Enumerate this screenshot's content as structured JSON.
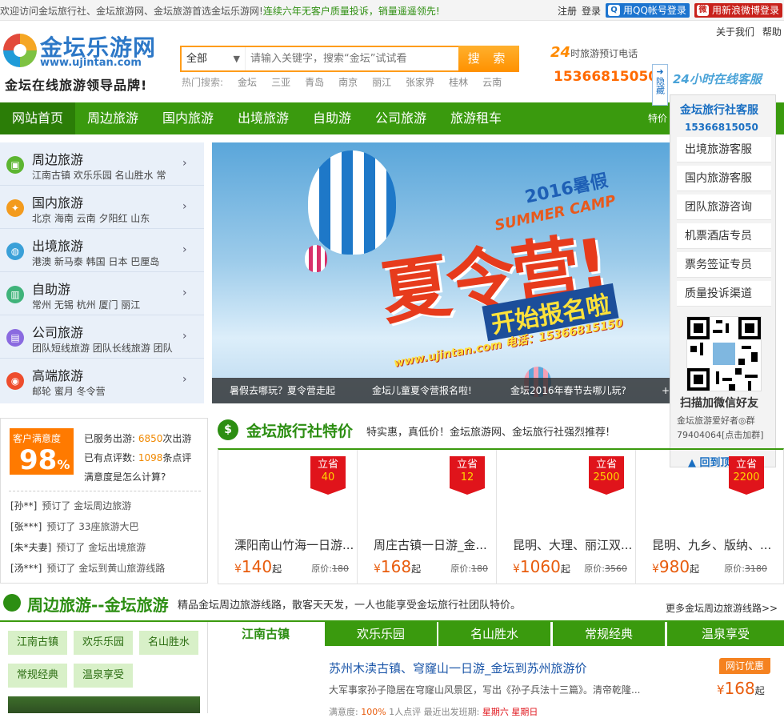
{
  "topbar": {
    "welcome": "欢迎访问金坛旅行社、金坛旅游网、金坛旅游首选金坛乐游网!",
    "slogan": "连续六年无客户质量投诉，销量遥遥领先!",
    "register": "注册",
    "login": "登录",
    "qq_login": "用QQ帐号登录",
    "weibo_login": "用新浪微博登录"
  },
  "header": {
    "logo_name": "金坛乐游网",
    "logo_url": "www.ujintan.com",
    "logo_slogan": "金坛在线旅游领导品牌!",
    "links": [
      "关于我们",
      "帮助"
    ],
    "search": {
      "select_value": "全部",
      "placeholder": "请输入关键字，搜索“金坛”试试看",
      "button": "搜 索",
      "hot_label": "热门搜索:",
      "hot_words": [
        "金坛",
        "三亚",
        "青岛",
        "南京",
        "丽江",
        "张家界",
        "桂林",
        "云南"
      ]
    },
    "hotline": {
      "prefix": "24",
      "suffix": "时",
      "label": "旅游预订电话",
      "number": "15366815050"
    }
  },
  "nav": {
    "items": [
      "网站首页",
      "周边旅游",
      "国内旅游",
      "出境旅游",
      "自助游",
      "公司旅游",
      "旅游租车"
    ],
    "active": "网站首页",
    "extra": "特价"
  },
  "categories": [
    {
      "title": "周边旅游",
      "sub": "江南古镇  欢乐乐园  名山胜水  常",
      "icon": "bus-icon",
      "color": "#5cb531"
    },
    {
      "title": "国内旅游",
      "sub": "北京  海南  云南  夕阳红  山东",
      "icon": "china-map-icon",
      "color": "#f39b1e"
    },
    {
      "title": "出境旅游",
      "sub": "港澳  新马泰  韩国  日本  巴厘岛",
      "icon": "globe-icon",
      "color": "#3aa0d8"
    },
    {
      "title": "自助游",
      "sub": "常州  无锡  杭州  厦门  丽江",
      "icon": "building-icon",
      "color": "#3fb37a"
    },
    {
      "title": "公司旅游",
      "sub": "团队短线旅游  团队长线旅游  团队",
      "icon": "document-icon",
      "color": "#8a6ae0"
    },
    {
      "title": "高端旅游",
      "sub": "邮轮  蜜月  冬令营",
      "icon": "camera-icon",
      "color": "#ee4d2d"
    }
  ],
  "banner": {
    "year_text": "2016暑假",
    "camp_text": "SUMMER CAMP",
    "main_text": "夏令营!",
    "sub_text": "开始报名啦",
    "contact_text": "www.ujintan.com 电话：15366815150",
    "tabs": [
      "暑假去哪玩？夏令营走起",
      "金坛儿童夏令营报名啦!",
      "金坛2016年春节去哪儿玩?",
      "+"
    ]
  },
  "float_service": {
    "tab_text": "隐藏",
    "header": "24小时在线客服",
    "title": "金坛旅行社客服",
    "tel": "15366815050",
    "items": [
      "出境旅游客服",
      "国内旅游客服",
      "团队旅游咨询",
      "机票酒店专员",
      "票务签证专员",
      "质量投诉渠道"
    ],
    "qr_text": "扫描加微信好友",
    "group_text": "金坛旅游爱好者◎群79404064[点击加群]",
    "back_top": "回到顶部"
  },
  "satisfaction": {
    "badge_label": "客户满意度",
    "badge_value": "98",
    "badge_unit": "%",
    "served_label": "已服务出游:",
    "served_value": "6850",
    "served_unit": "次出游",
    "reviews_label": "已有点评数:",
    "reviews_value": "1098",
    "reviews_unit": "条点评",
    "how": "满意度是怎么计算?",
    "orders": [
      {
        "who": "[孙**]",
        "what": "预订了  金坛周边旅游"
      },
      {
        "who": "[张***]",
        "what": "预订了  33座旅游大巴"
      },
      {
        "who": "[朱*夫妻]",
        "what": "预订了  金坛出境旅游"
      },
      {
        "who": "[汤***]",
        "what": "预订了  金坛到黄山旅游线路"
      }
    ]
  },
  "deals": {
    "title": "金坛旅行社特价",
    "subtitle": "特实惠，真低价！金坛旅游网、金坛旅行社强烈推荐!",
    "items": [
      {
        "tag": "立省",
        "save": "40",
        "name": "溧阳南山竹海一日游...",
        "price": "140",
        "orig_label": "原价:",
        "orig": "180"
      },
      {
        "tag": "立省",
        "save": "12",
        "name": "周庄古镇一日游_金...",
        "price": "168",
        "orig_label": "原价:",
        "orig": "180"
      },
      {
        "tag": "立省",
        "save": "2500",
        "name": "昆明、大理、丽江双...",
        "price": "1060",
        "orig_label": "原价:",
        "orig": "3560"
      },
      {
        "tag": "立省",
        "save": "2200",
        "name": "昆明、九乡、版纳、...",
        "price": "980",
        "orig_label": "原价:",
        "orig": "3180"
      }
    ],
    "currency": "¥",
    "unit": "起"
  },
  "section2": {
    "title": "周边旅游--金坛旅游",
    "subtitle": "精品金坛周边旅游线路，散客天天发，一人也能享受金坛旅行社团队特价。",
    "more": "更多金坛周边旅游线路>>",
    "tags": [
      "江南古镇",
      "欢乐乐园",
      "名山胜水",
      "常规经典",
      "温泉享受"
    ],
    "tabs": [
      "江南古镇",
      "欢乐乐园",
      "名山胜水",
      "常规经典",
      "温泉享受"
    ],
    "route": {
      "title": "苏州木渎古镇、穹窿山一日游_金坛到苏州旅游价",
      "desc": "大军事家孙子隐居在穹窿山风景区，写出《孙子兵法十三篇》。清帝乾隆...",
      "badge": "网订优惠",
      "price": "168",
      "meta_label": "满意度:",
      "meta_pct": "100%",
      "meta_reviews": "1人点评",
      "meta_dep_label": "最近出发班期:",
      "meta_dep": "星期六  星期日"
    }
  }
}
